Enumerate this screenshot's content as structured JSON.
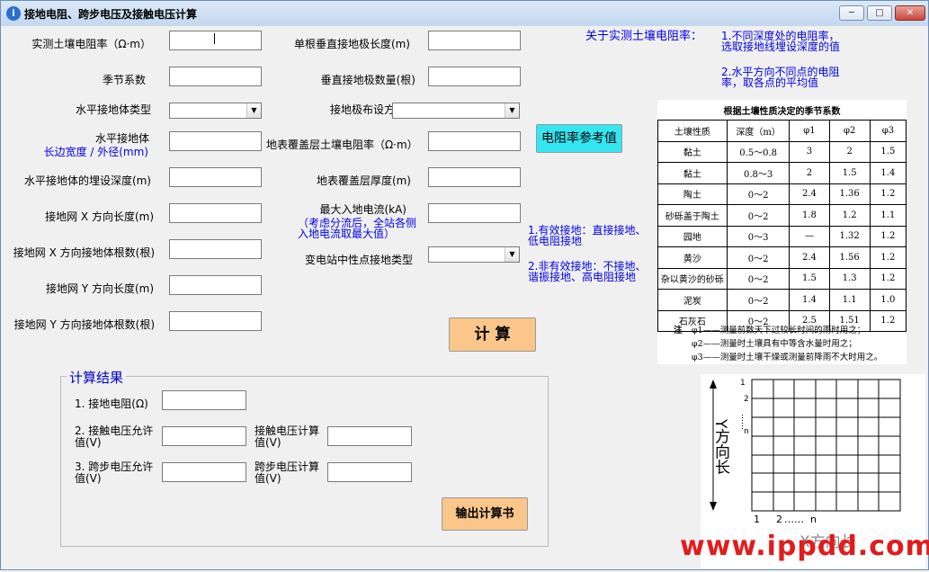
{
  "window": {
    "title": "接地电阻、跨步电压及接触电压计算",
    "app_icon": "info-icon"
  },
  "labels": {
    "soil_resistivity": "实测土壤电阻率（Ω·m）",
    "season_coef": "季节系数",
    "horiz_type": "水平接地体类型",
    "horiz_width_1": "水平接地体",
    "horiz_width_2": "长边宽度 / 外径(mm)",
    "horiz_depth": "水平接地体的埋设深度(m)",
    "grid_x_len": "接地网 X 方向长度(m)",
    "grid_x_count": "接地网 X 方向接地体根数(根)",
    "grid_y_len": "接地网 Y 方向长度(m)",
    "grid_y_count": "接地网 Y 方向接地体根数(根)",
    "vert_len": "单根垂直接地极长度(m)",
    "vert_count": "垂直接地极数量(根)",
    "layout_mode": "接地极布设方式",
    "cover_res": "地表覆盖层土壤电阻率（Ω·m）",
    "cover_thick": "地表覆盖层厚度(m)",
    "max_current_1": "最大入地电流(kA)",
    "max_current_2": "（考虑分流后，全站各侧",
    "max_current_3": "入地电流取最大值）",
    "neutral_type": "变电站中性点接地类型"
  },
  "buttons": {
    "ref": "电阻率参考值",
    "calc": "计 算",
    "export": "输出计算书"
  },
  "notes": {
    "soil_header": "关于实测土壤电阻率：",
    "soil_1a": "1.不同深度处的电阻率，",
    "soil_1b": "选取接地线埋设深度的值",
    "soil_2a": "2.水平方向不同点的电阻",
    "soil_2b": "率，取各点的平均值",
    "ground_1a": "1.有效接地：直接接地、",
    "ground_1b": "低电阻接地",
    "ground_2a": "2.非有效接地：不接地、",
    "ground_2b": "谐振接地、高电阻接地"
  },
  "results": {
    "legend": "计算结果",
    "r1": "1. 接地电阻(Ω)",
    "r2a": "2. 接触电压允许",
    "r2b": "值(V)",
    "r2c": "接触电压计算",
    "r2d": "值(V)",
    "r3a": "3. 跨步电压允许",
    "r3b": "值(V)",
    "r3c": "跨步电压计算",
    "r3d": "值(V)"
  },
  "season_table": {
    "title": "根据土壤性质决定的季节系数",
    "headers": [
      "土壤性质",
      "深度（m）",
      "φ1",
      "φ2",
      "φ3"
    ],
    "rows": [
      [
        "黏土",
        "0.5～0.8",
        "3",
        "2",
        "1.5"
      ],
      [
        "黏土",
        "0.8～3",
        "2",
        "1.5",
        "1.4"
      ],
      [
        "陶土",
        "0～2",
        "2.4",
        "1.36",
        "1.2"
      ],
      [
        "砂砾盖于陶土",
        "0～2",
        "1.8",
        "1.2",
        "1.1"
      ],
      [
        "园地",
        "0～3",
        "—",
        "1.32",
        "1.2"
      ],
      [
        "黄沙",
        "0～2",
        "2.4",
        "1.56",
        "1.2"
      ],
      [
        "杂以黄沙的砂砾",
        "0～2",
        "1.5",
        "1.3",
        "1.2"
      ],
      [
        "泥炭",
        "0～2",
        "1.4",
        "1.1",
        "1.0"
      ],
      [
        "石灰石",
        "0～2",
        "2.5",
        "1.51",
        "1.2"
      ]
    ],
    "note_head": "注",
    "note_1": "φ1——测量前数天下过较长时间的雨时用之；",
    "note_2": "φ2——测量时土壤具有中等含水量时用之；",
    "note_3": "φ3——测量时土壤干燥或测量前降雨不大时用之。"
  },
  "grid_diagram": {
    "y_label": "Y方向长",
    "x_label": "X方向长",
    "y_ticks": [
      "1",
      "2",
      "……",
      "n"
    ],
    "x_ticks": [
      "1",
      "2",
      "……",
      "n"
    ]
  },
  "watermark": "www.ippdd.com",
  "colors": {
    "calc_btn": "#fbc68a",
    "ref_btn": "#33e6f2",
    "title_bg": "#c8daef"
  }
}
